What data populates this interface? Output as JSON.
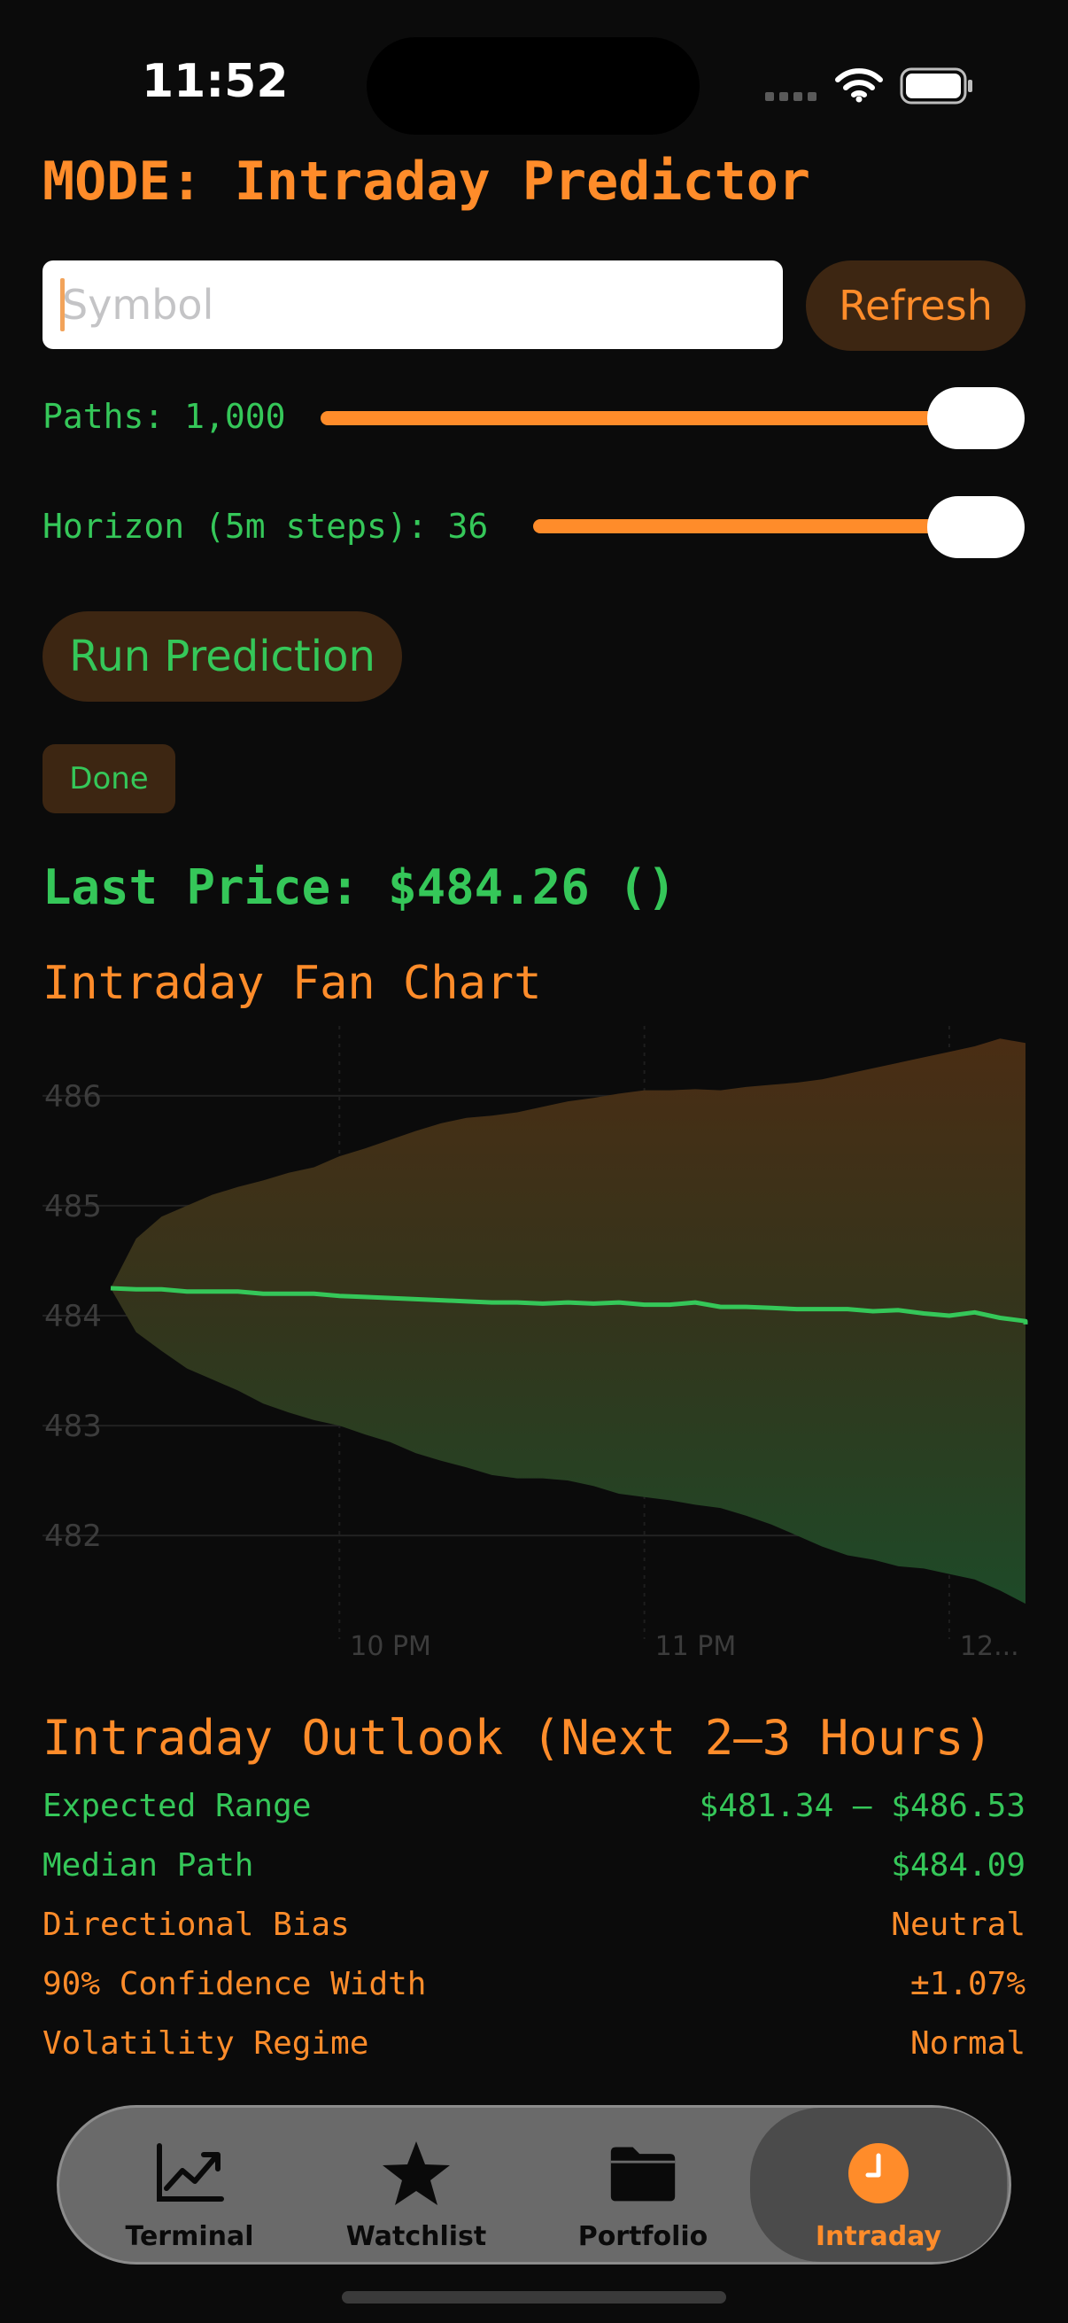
{
  "status": {
    "time": "11:52"
  },
  "header": {
    "mode_title": "MODE: Intraday Predictor"
  },
  "controls": {
    "symbol_placeholder": "Symbol",
    "symbol_value": "",
    "refresh_label": "Refresh",
    "paths_label": "Paths: 1,000",
    "paths_fraction": 1.0,
    "horizon_label": "Horizon (5m steps): 36",
    "horizon_fraction": 1.0,
    "run_label": "Run Prediction",
    "done_label": "Done"
  },
  "last_price": "Last Price: $484.26 ()",
  "fan_chart_title": "Intraday Fan Chart",
  "chart_data": {
    "type": "area",
    "title": "Intraday Fan Chart",
    "xlabel": "",
    "ylabel": "",
    "y_ticks": [
      482,
      483,
      484,
      485,
      486
    ],
    "ylim": [
      481.3,
      486.7
    ],
    "x_tick_labels": [
      {
        "step": 9,
        "label": "10 PM"
      },
      {
        "step": 21,
        "label": "11 PM"
      },
      {
        "step": 33,
        "label": "12..."
      }
    ],
    "x_steps": 36,
    "grid": true,
    "colors": {
      "upper": "#4a2d14",
      "lower": "#1e4a28",
      "median": "#35c759"
    },
    "series": [
      {
        "values": [
          484.25,
          484.7,
          484.9,
          485.0,
          485.1,
          485.17,
          485.23,
          485.3,
          485.35,
          485.45,
          485.52,
          485.6,
          485.68,
          485.75,
          485.8,
          485.82,
          485.85,
          485.9,
          485.95,
          485.98,
          486.02,
          486.05,
          486.05,
          486.06,
          486.05,
          486.08,
          486.1,
          486.12,
          486.15,
          486.2,
          486.25,
          486.3,
          486.35,
          486.4,
          486.45,
          486.52,
          486.48
        ]
      },
      {
        "values": [
          484.25,
          484.24,
          484.24,
          484.22,
          484.22,
          484.22,
          484.2,
          484.2,
          484.2,
          484.18,
          484.17,
          484.16,
          484.15,
          484.14,
          484.13,
          484.12,
          484.12,
          484.11,
          484.12,
          484.11,
          484.12,
          484.1,
          484.1,
          484.12,
          484.08,
          484.08,
          484.07,
          484.06,
          484.06,
          484.06,
          484.04,
          484.05,
          484.02,
          484.0,
          484.03,
          483.98,
          483.95,
          483.92
        ]
      },
      {
        "values": [
          484.25,
          483.85,
          483.68,
          483.52,
          483.42,
          483.32,
          483.2,
          483.12,
          483.05,
          483.0,
          482.92,
          482.85,
          482.75,
          482.68,
          482.62,
          482.55,
          482.52,
          482.52,
          482.5,
          482.45,
          482.38,
          482.35,
          482.32,
          482.28,
          482.25,
          482.18,
          482.1,
          482.0,
          481.9,
          481.82,
          481.78,
          481.72,
          481.7,
          481.65,
          481.6,
          481.5,
          481.38
        ]
      }
    ]
  },
  "outlook": {
    "title": "Intraday Outlook (Next 2–3 Hours)",
    "rows": [
      {
        "label": "Expected Range",
        "value": "$481.34 — $486.53",
        "color": "#35c759"
      },
      {
        "label": "Median Path",
        "value": "$484.09",
        "color": "#35c759"
      },
      {
        "label": "Directional Bias",
        "value": "Neutral",
        "color": "#ff8c2a"
      },
      {
        "label": "90% Confidence Width",
        "value": "±1.07%",
        "color": "#ff8c2a"
      },
      {
        "label": "Volatility Regime",
        "value": "Normal",
        "color": "#ff8c2a"
      }
    ]
  },
  "tabs": [
    {
      "label": "Terminal",
      "icon": "chart-line-icon"
    },
    {
      "label": "Watchlist",
      "icon": "star-icon"
    },
    {
      "label": "Portfolio",
      "icon": "folder-icon"
    },
    {
      "label": "Intraday",
      "icon": "clock-icon",
      "active": true
    }
  ]
}
